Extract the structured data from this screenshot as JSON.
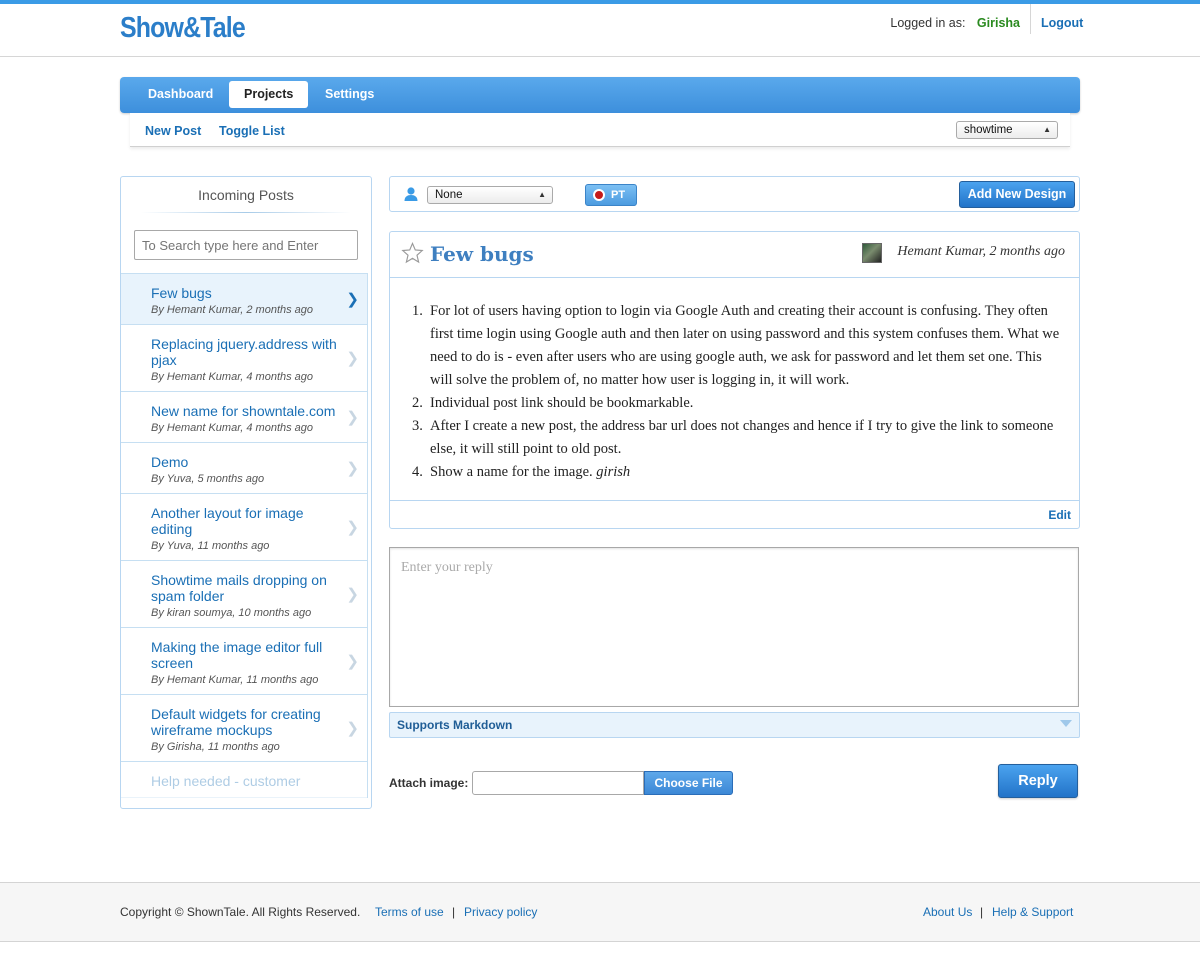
{
  "app": {
    "logo": "Show&Tale"
  },
  "header": {
    "logged_in_label": "Logged in as:",
    "username": "Girisha",
    "logout": "Logout"
  },
  "nav": {
    "tabs": [
      {
        "label": "Dashboard",
        "active": false
      },
      {
        "label": "Projects",
        "active": true
      },
      {
        "label": "Settings",
        "active": false
      }
    ]
  },
  "subnav": {
    "new_post": "New Post",
    "toggle_list": "Toggle List",
    "project_select": "showtime"
  },
  "sidebar": {
    "title": "Incoming Posts",
    "search_placeholder": "To Search type here and Enter",
    "posts": [
      {
        "title": "Few bugs",
        "meta": "By Hemant Kumar, 2 months ago",
        "active": true
      },
      {
        "title": "Replacing jquery.address with pjax",
        "meta": "By Hemant Kumar, 4 months ago"
      },
      {
        "title": "New name for showntale.com",
        "meta": "By Hemant Kumar, 4 months ago"
      },
      {
        "title": "Demo",
        "meta": "By Yuva, 5 months ago"
      },
      {
        "title": "Another layout for image editing",
        "meta": "By Yuva, 11 months ago"
      },
      {
        "title": "Showtime mails dropping on spam folder",
        "meta": "By kiran soumya, 10 months ago"
      },
      {
        "title": "Making the image editor full screen",
        "meta": "By Hemant Kumar, 11 months ago"
      },
      {
        "title": "Default widgets for creating wireframe mockups",
        "meta": "By Girisha, 11 months ago"
      },
      {
        "title": "Help needed - customer",
        "meta": "",
        "faded": true
      }
    ]
  },
  "toolbar": {
    "assignee_select": "None",
    "pt_label": "PT",
    "add_design": "Add New Design"
  },
  "post": {
    "title": "Few bugs",
    "author": "Hemant Kumar, 2 months ago",
    "items": [
      {
        "num": "1.",
        "text": "For lot of users having option to login via Google Auth and creating their account is confusing. They often first time login using Google auth and then later on using password and this system confuses them. What we need to do is - even after users who are using google auth, we ask for password and let them set one. This will solve the problem of, no matter how user is logging in, it will work."
      },
      {
        "num": "2.",
        "text": "Individual post link should be bookmarkable."
      },
      {
        "num": "3.",
        "text": "After I create a new post, the address bar url does not changes and hence if I try to give the link to someone else, it will still point to old post."
      },
      {
        "num": "4.",
        "text": "Show a name for the image.",
        "signature": "girish"
      }
    ],
    "edit": "Edit"
  },
  "reply": {
    "placeholder": "Enter your reply",
    "markdown_label": "Supports Markdown",
    "attach_label": "Attach image:",
    "choose_file": "Choose File",
    "submit": "Reply"
  },
  "footer": {
    "copyright": "Copyright © ShownTale. All Rights Reserved.",
    "terms": "Terms of use",
    "separator": "|",
    "privacy": "Privacy policy",
    "about": "About Us",
    "help": "Help & Support"
  },
  "colors": {
    "accent": "#3a9be6",
    "link": "#1a6fb5",
    "username": "#2a8a1f",
    "panel_border": "#b8d6f1"
  },
  "icons": {
    "user": "user-icon",
    "star": "star-icon",
    "chevron": "chevron-right-icon",
    "record": "record-icon"
  }
}
